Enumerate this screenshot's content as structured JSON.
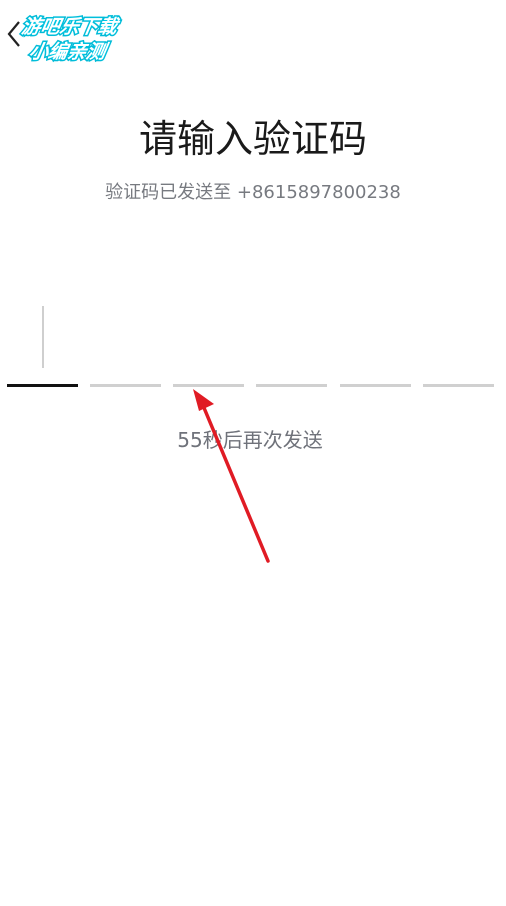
{
  "watermark": {
    "line1": "游吧乐下载",
    "line2": "小编亲测"
  },
  "back": {
    "icon": "chevron-left-icon"
  },
  "header": {
    "title": "请输入验证码",
    "subtitle": "验证码已发送至 +8615897800238"
  },
  "code_input": {
    "length": 6,
    "active_index": 0
  },
  "resend": {
    "text": "55秒后再次发送"
  },
  "colors": {
    "annotation_arrow": "#e01b24",
    "active_slot": "#111111",
    "inactive_slot": "#d0d0d0"
  }
}
